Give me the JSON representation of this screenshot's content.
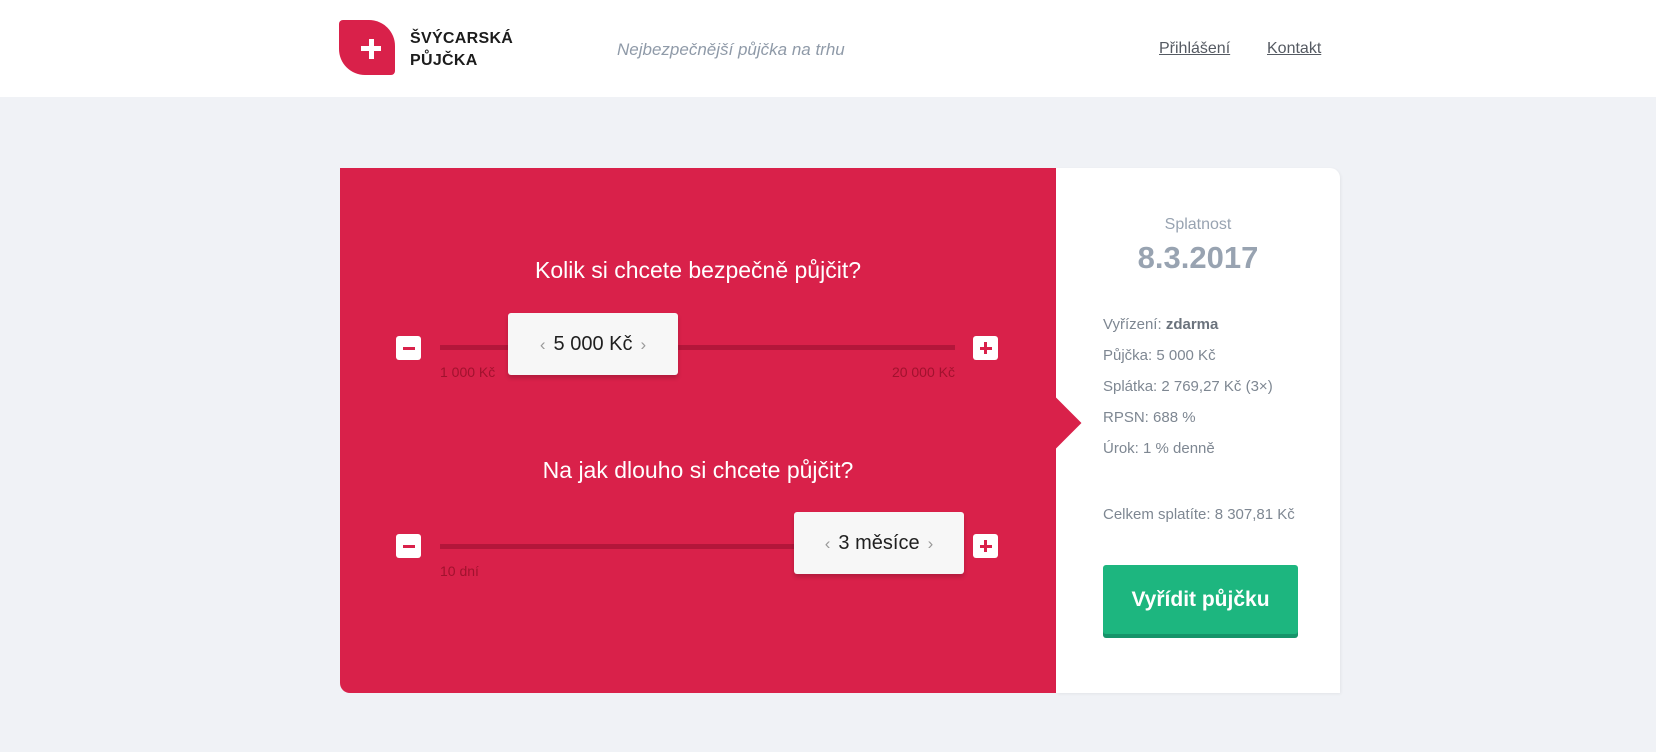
{
  "header": {
    "brand_line1": "ŠVÝCARSKÁ",
    "brand_line2": "PŮJČKA",
    "tagline": "Nejbezpečnější půjčka na trhu",
    "nav": {
      "login": "Přihlášení",
      "contact": "Kontakt"
    }
  },
  "calculator": {
    "amount": {
      "question": "Kolik si chcete bezpečně půjčit?",
      "value": "5 000 Kč",
      "min_label": "1 000 Kč",
      "max_label": "20 000 Kč"
    },
    "duration": {
      "question": "Na jak dlouho si chcete půjčit?",
      "value": "3 měsíce",
      "min_label": "10 dní"
    }
  },
  "summary": {
    "due_label": "Splatnost",
    "due_date": "8.3.2017",
    "processing_label": "Vyřízení:",
    "processing_value": "zdarma",
    "loan": "Půjčka: 5 000 Kč",
    "installment": "Splátka: 2 769,27 Kč (3×)",
    "rpsn": "RPSN: 688 %",
    "interest": "Úrok: 1 % denně",
    "total": "Celkem splatíte: 8 307,81 Kč",
    "cta": "Vyřídit půjčku"
  },
  "colors": {
    "brand": "#d9214a",
    "cta": "#1db67f",
    "muted": "#98a3b1"
  },
  "icons": [
    "plus-logo-icon",
    "minus-icon",
    "plus-icon",
    "chevron-left-icon",
    "chevron-right-icon"
  ]
}
